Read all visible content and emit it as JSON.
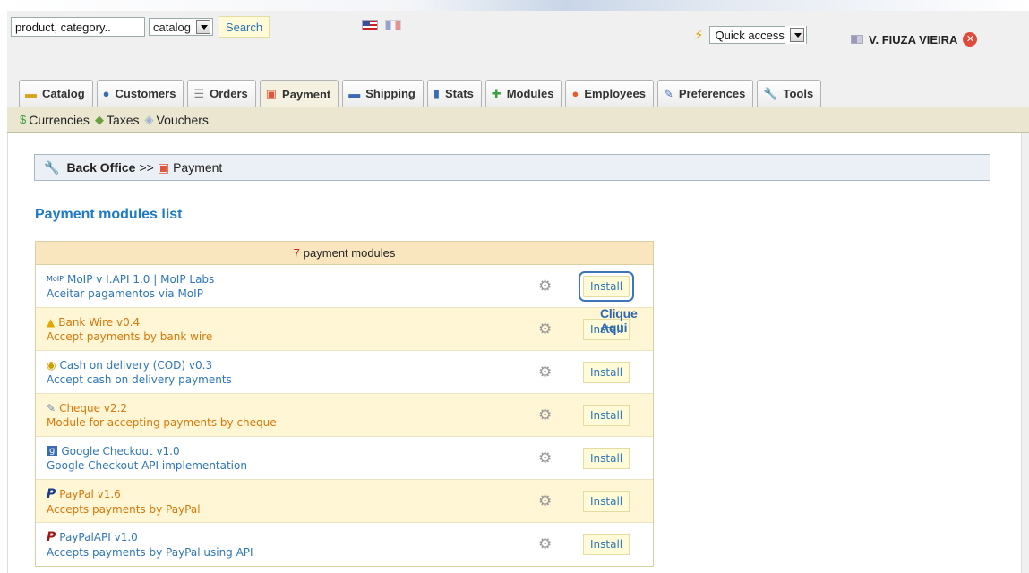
{
  "search": {
    "query": "product, category..",
    "scope_selected": "catalog",
    "button_label": "Search"
  },
  "languages": [
    {
      "flag": "flag-us-icon"
    },
    {
      "flag": "flag-fr-icon"
    }
  ],
  "quick_access": {
    "label": "Quick access"
  },
  "user": {
    "name": "V. FIUZA VIEIRA"
  },
  "tabs": [
    {
      "label": "Catalog",
      "icon": "folder-icon"
    },
    {
      "label": "Customers",
      "icon": "customers-icon"
    },
    {
      "label": "Orders",
      "icon": "orders-icon"
    },
    {
      "label": "Payment",
      "icon": "payment-icon",
      "active": true
    },
    {
      "label": "Shipping",
      "icon": "shipping-icon"
    },
    {
      "label": "Stats",
      "icon": "stats-icon"
    },
    {
      "label": "Modules",
      "icon": "modules-icon"
    },
    {
      "label": "Employees",
      "icon": "employees-icon"
    },
    {
      "label": "Preferences",
      "icon": "preferences-icon"
    },
    {
      "label": "Tools",
      "icon": "tools-icon"
    }
  ],
  "subnav": [
    {
      "label": "Currencies",
      "icon": "currency-icon"
    },
    {
      "label": "Taxes",
      "icon": "taxes-icon"
    },
    {
      "label": "Vouchers",
      "icon": "vouchers-icon"
    }
  ],
  "breadcrumb": {
    "root": "Back Office",
    "separator": ">>",
    "current": "Payment"
  },
  "page_title": "Payment modules list",
  "modules_header": {
    "count": "7",
    "label": "payment modules"
  },
  "modules": [
    {
      "title": "MoIP v I.API 1.0 | MoIP Labs",
      "desc": "Aceitar pagamentos via MoIP",
      "install": "Install",
      "icon": "moip-logo-icon",
      "color": "blue",
      "highlight": true
    },
    {
      "title": "Bank Wire v0.4",
      "desc": "Accept payments by bank wire",
      "install": "Install",
      "icon": "bankwire-icon",
      "color": "orange"
    },
    {
      "title": "Cash on delivery (COD) v0.3",
      "desc": "Accept cash on delivery payments",
      "install": "Install",
      "icon": "cod-icon",
      "color": "blue"
    },
    {
      "title": "Cheque v2.2",
      "desc": "Module for accepting payments by cheque",
      "install": "Install",
      "icon": "cheque-icon",
      "color": "orange"
    },
    {
      "title": "Google Checkout v1.0",
      "desc": "Google Checkout API implementation",
      "install": "Install",
      "icon": "google-checkout-icon",
      "color": "blue"
    },
    {
      "title": "PayPal v1.6",
      "desc": "Accepts payments by PayPal",
      "install": "Install",
      "icon": "paypal-icon",
      "color": "orange"
    },
    {
      "title": "PayPalAPI v1.0",
      "desc": "Accepts payments by PayPal using API",
      "install": "Install",
      "icon": "paypalapi-icon",
      "color": "blue"
    }
  ],
  "annotation": {
    "label": "Clique Aqui"
  },
  "colors": {
    "link_blue": "#2f77b6",
    "orange": "#d6780a",
    "title_blue": "#1f7ac1",
    "highlight_outline": "#3f75b8"
  }
}
